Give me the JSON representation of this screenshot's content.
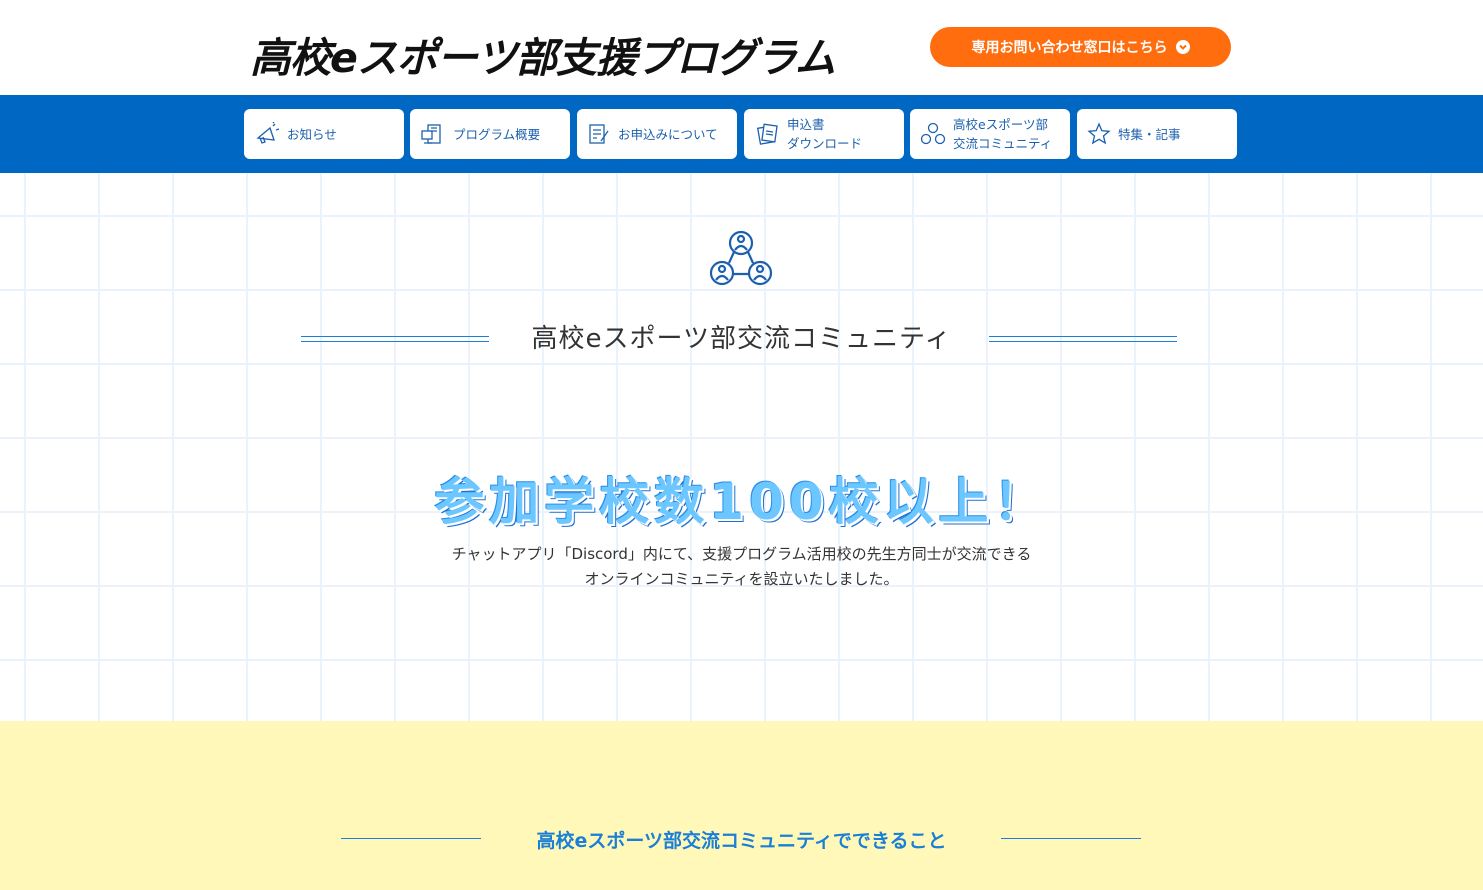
{
  "header": {
    "logo_text": "高校eスポーツ部支援プログラム",
    "contact_label": "専用お問い合わせ窓口はこちら"
  },
  "nav": {
    "items": [
      {
        "lines": [
          "お知らせ"
        ],
        "icon": "megaphone-icon"
      },
      {
        "lines": [
          "プログラム概要"
        ],
        "icon": "computer-icon"
      },
      {
        "lines": [
          "お申込みについて"
        ],
        "icon": "form-icon"
      },
      {
        "lines": [
          "申込書",
          "ダウンロード"
        ],
        "icon": "document-download-icon"
      },
      {
        "lines": [
          "高校eスポーツ部",
          "交流コミュニティ"
        ],
        "icon": "community-icon"
      },
      {
        "lines": [
          "特集・記事"
        ],
        "icon": "star-icon"
      }
    ]
  },
  "main": {
    "section_title": "高校eスポーツ部交流コミュニティ",
    "headline": "参加学校数100校以上！",
    "description_line1": "チャットアプリ「Discord」内にて、支援プログラム活用校の先生方同士が交流できる",
    "description_line2": "オンラインコミュニティを設立いたしました。"
  },
  "features": {
    "title": "高校eスポーツ部交流コミュニティでできること"
  },
  "colors": {
    "nav_blue": "#0068c3",
    "accent_orange": "#ff6d0e",
    "text_blue": "#1a7fd6",
    "yellow_bg": "#fff8b8"
  }
}
